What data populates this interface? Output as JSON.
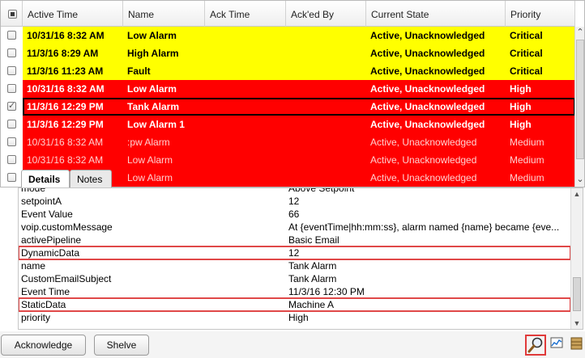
{
  "table": {
    "columns": [
      "Active Time",
      "Name",
      "Ack Time",
      "Ack'ed By",
      "Current State",
      "Priority"
    ],
    "rows": [
      {
        "active_time": "10/31/16 8:32 AM",
        "name": "Low Alarm",
        "ack_time": "",
        "acked_by": "",
        "state": "Active, Unacknowledged",
        "priority": "Critical",
        "bg": "#ffff00",
        "fg": "#000000",
        "bold": true,
        "checked": false
      },
      {
        "active_time": "11/3/16 8:29 AM",
        "name": "High Alarm",
        "ack_time": "",
        "acked_by": "",
        "state": "Active, Unacknowledged",
        "priority": "Critical",
        "bg": "#ffff00",
        "fg": "#000000",
        "bold": true,
        "checked": false
      },
      {
        "active_time": "11/3/16 11:23 AM",
        "name": "Fault",
        "ack_time": "",
        "acked_by": "",
        "state": "Active, Unacknowledged",
        "priority": "Critical",
        "bg": "#ffff00",
        "fg": "#000000",
        "bold": true,
        "checked": false
      },
      {
        "active_time": "10/31/16 8:32 AM",
        "name": "Low Alarm",
        "ack_time": "",
        "acked_by": "",
        "state": "Active, Unacknowledged",
        "priority": "High",
        "bg": "#ff0000",
        "fg": "#ffffff",
        "bold": true,
        "checked": false
      },
      {
        "active_time": "11/3/16 12:29 PM",
        "name": "Tank Alarm",
        "ack_time": "",
        "acked_by": "",
        "state": "Active, Unacknowledged",
        "priority": "High",
        "bg": "#ff0000",
        "fg": "#ffffff",
        "bold": true,
        "checked": true,
        "selected": true
      },
      {
        "active_time": "11/3/16 12:29 PM",
        "name": "Low Alarm 1",
        "ack_time": "",
        "acked_by": "",
        "state": "Active, Unacknowledged",
        "priority": "High",
        "bg": "#ff0000",
        "fg": "#ffffff",
        "bold": true,
        "checked": false
      },
      {
        "active_time": "10/31/16 8:32 AM",
        "name": ":pw Alarm",
        "ack_time": "",
        "acked_by": "",
        "state": "Active, Unacknowledged",
        "priority": "Medium",
        "bg": "#ff0000",
        "fg": "#ffd0d0",
        "bold": false,
        "checked": false
      },
      {
        "active_time": "10/31/16 8:32 AM",
        "name": "Low Alarm",
        "ack_time": "",
        "acked_by": "",
        "state": "Active, Unacknowledged",
        "priority": "Medium",
        "bg": "#ff0000",
        "fg": "#ffd0d0",
        "bold": false,
        "checked": false
      },
      {
        "active_time": "",
        "name": "Low Alarm",
        "ack_time": "",
        "acked_by": "",
        "state": "Active, Unacknowledged",
        "priority": "Medium",
        "bg": "#ff0000",
        "fg": "#ffd0d0",
        "bold": false,
        "checked": false
      }
    ]
  },
  "tabs": {
    "details": "Details",
    "notes": "Notes"
  },
  "details": [
    {
      "key": "mode",
      "value": "Above Setpoint"
    },
    {
      "key": "setpointA",
      "value": "12"
    },
    {
      "key": "Event Value",
      "value": "66"
    },
    {
      "key": "voip.customMessage",
      "value": "At {eventTime|hh:mm:ss}, alarm named {name} became {eve..."
    },
    {
      "key": "activePipeline",
      "value": "Basic Email"
    },
    {
      "key": "DynamicData",
      "value": "12",
      "highlight": true
    },
    {
      "key": "name",
      "value": "Tank Alarm"
    },
    {
      "key": "CustomEmailSubject",
      "value": "Tank Alarm"
    },
    {
      "key": "Event Time",
      "value": "11/3/16 12:30 PM"
    },
    {
      "key": "StaticData",
      "value": "Machine A",
      "highlight": true
    },
    {
      "key": "priority",
      "value": "High"
    }
  ],
  "toolbar": {
    "acknowledge": "Acknowledge",
    "shelve": "Shelve"
  },
  "icons": {
    "search": "magnifier-icon",
    "chart": "chart-icon",
    "database": "database-icon"
  },
  "colors": {
    "highlight_border": "#e04848",
    "critical_bg": "#ffff00",
    "high_bg": "#ff0000"
  }
}
